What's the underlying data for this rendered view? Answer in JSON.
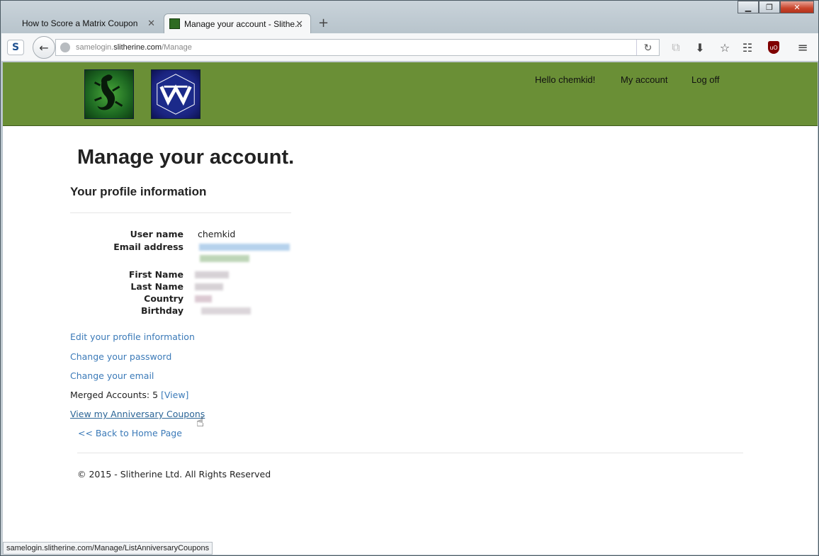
{
  "browser": {
    "tabs": [
      {
        "label": "How to Score a Matrix Coupon"
      },
      {
        "label": "Manage your account - Slithe..."
      }
    ],
    "url": {
      "prefix": "samelogin.",
      "host": "slitherine.com",
      "path": "/Manage"
    },
    "status_text": "samelogin.slitherine.com/Manage/ListAnniversaryCoupons"
  },
  "header": {
    "greeting": "Hello chemkid!",
    "my_account": "My account",
    "log_off": "Log off"
  },
  "page": {
    "title": "Manage your account.",
    "subtitle": "Your profile information",
    "profile": {
      "username_label": "User name",
      "username_value": "chemkid",
      "email_label": "Email address",
      "first_name_label": "First Name",
      "last_name_label": "Last Name",
      "country_label": "Country",
      "birthday_label": "Birthday"
    },
    "links": {
      "edit_profile": "Edit your profile information",
      "change_password": "Change your password",
      "change_email": "Change your email",
      "merged_accounts": "Merged Accounts: 5",
      "merged_view": "[View]",
      "anniversary_coupons": "View my Anniversary Coupons",
      "back_home": "<< Back to Home Page"
    },
    "footer": "© 2015 - Slitherine Ltd. All Rights Reserved"
  },
  "colors": {
    "header_green": "#6a8f36",
    "link_blue": "#3b7ab8"
  }
}
